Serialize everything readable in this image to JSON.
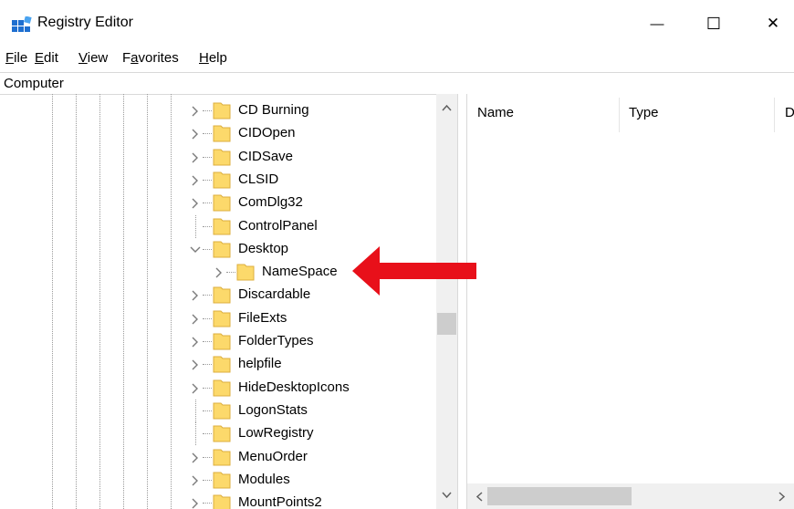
{
  "window": {
    "title": "Registry Editor",
    "minimize_glyph": "—",
    "maximize_glyph": "☐",
    "close_glyph": "✕"
  },
  "menu": {
    "items": [
      {
        "label": "File",
        "access_key": "F"
      },
      {
        "label": "Edit",
        "access_key": "E"
      },
      {
        "label": "View",
        "access_key": "V"
      },
      {
        "label": "Favorites",
        "access_key": "a"
      },
      {
        "label": "Help",
        "access_key": "H"
      }
    ]
  },
  "address_bar": {
    "path": "Computer"
  },
  "tree": {
    "nodes": [
      {
        "label": "CD Burning",
        "level": 0,
        "expander": "collapsed"
      },
      {
        "label": "CIDOpen",
        "level": 0,
        "expander": "collapsed"
      },
      {
        "label": "CIDSave",
        "level": 0,
        "expander": "collapsed"
      },
      {
        "label": "CLSID",
        "level": 0,
        "expander": "collapsed"
      },
      {
        "label": "ComDlg32",
        "level": 0,
        "expander": "collapsed"
      },
      {
        "label": "ControlPanel",
        "level": 0,
        "expander": "none"
      },
      {
        "label": "Desktop",
        "level": 0,
        "expander": "expanded"
      },
      {
        "label": "NameSpace",
        "level": 1,
        "expander": "collapsed"
      },
      {
        "label": "Discardable",
        "level": 0,
        "expander": "collapsed"
      },
      {
        "label": "FileExts",
        "level": 0,
        "expander": "collapsed"
      },
      {
        "label": "FolderTypes",
        "level": 0,
        "expander": "collapsed"
      },
      {
        "label": "helpfile",
        "level": 0,
        "expander": "collapsed"
      },
      {
        "label": "HideDesktopIcons",
        "level": 0,
        "expander": "collapsed"
      },
      {
        "label": "LogonStats",
        "level": 0,
        "expander": "none"
      },
      {
        "label": "LowRegistry",
        "level": 0,
        "expander": "none"
      },
      {
        "label": "MenuOrder",
        "level": 0,
        "expander": "collapsed"
      },
      {
        "label": "Modules",
        "level": 0,
        "expander": "collapsed"
      },
      {
        "label": "MountPoints2",
        "level": 0,
        "expander": "collapsed"
      }
    ]
  },
  "values_pane": {
    "columns": [
      "Name",
      "Type",
      "D"
    ]
  },
  "colors": {
    "folder_fill": "#fcd96b",
    "folder_edge": "#dcae3c",
    "arrow": "#e8101a",
    "chevron": "#7a7a7a",
    "scroll_thumb": "#cdcdcd",
    "scroll_track": "#f0f0f0"
  },
  "icons": {
    "app": "registry-icon",
    "tree_folder": "folder-icon",
    "expand": "chevron-right-icon",
    "collapse": "chevron-down-icon",
    "annotation": "red-arrow-icon"
  }
}
